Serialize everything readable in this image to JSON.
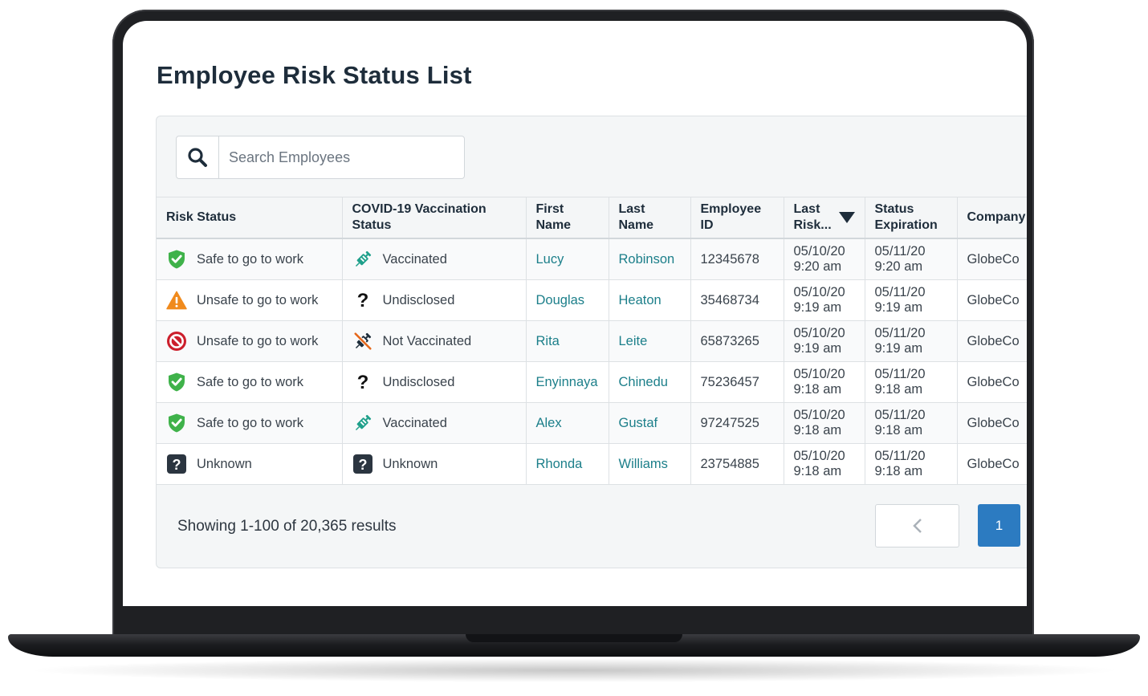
{
  "page": {
    "title": "Employee Risk Status List"
  },
  "search": {
    "placeholder": "Search Employees"
  },
  "table": {
    "headers": {
      "risk_status": "Risk Status",
      "vaccination": "COVID-19 Vaccination Status",
      "first_name": "First Name",
      "last_name": "Last Name",
      "employee_id": "Employee ID",
      "last_risk": "Last Risk...",
      "status_expiration": "Status Expiration",
      "company": "Company"
    },
    "rows": [
      {
        "risk_icon": "shield-check-icon",
        "risk": "Safe to go to work",
        "vacc_icon": "syringe-icon",
        "vacc": "Vaccinated",
        "first": "Lucy",
        "last": "Robinson",
        "id": "12345678",
        "last_risk_date": "05/10/20",
        "last_risk_time": "9:20 am",
        "exp_date": "05/11/20",
        "exp_time": "9:20 am",
        "company": "GlobeCo"
      },
      {
        "risk_icon": "warning-icon",
        "risk": "Unsafe to go to work",
        "vacc_icon": "question-icon",
        "vacc": "Undisclosed",
        "first": "Douglas",
        "last": "Heaton",
        "id": "35468734",
        "last_risk_date": "05/10/20",
        "last_risk_time": "9:19 am",
        "exp_date": "05/11/20",
        "exp_time": "9:19 am",
        "company": "GlobeCo"
      },
      {
        "risk_icon": "prohibited-icon",
        "risk": "Unsafe to go to work",
        "vacc_icon": "syringe-crossed-icon",
        "vacc": "Not Vaccinated",
        "first": "Rita",
        "last": "Leite",
        "id": "65873265",
        "last_risk_date": "05/10/20",
        "last_risk_time": "9:19 am",
        "exp_date": "05/11/20",
        "exp_time": "9:19 am",
        "company": "GlobeCo"
      },
      {
        "risk_icon": "shield-check-icon",
        "risk": "Safe to go to work",
        "vacc_icon": "question-icon",
        "vacc": "Undisclosed",
        "first": "Enyinnaya",
        "last": "Chinedu",
        "id": "75236457",
        "last_risk_date": "05/10/20",
        "last_risk_time": "9:18 am",
        "exp_date": "05/11/20",
        "exp_time": "9:18 am",
        "company": "GlobeCo"
      },
      {
        "risk_icon": "shield-check-icon",
        "risk": "Safe to go to work",
        "vacc_icon": "syringe-icon",
        "vacc": "Vaccinated",
        "first": "Alex",
        "last": "Gustaf",
        "id": "97247525",
        "last_risk_date": "05/10/20",
        "last_risk_time": "9:18 am",
        "exp_date": "05/11/20",
        "exp_time": "9:18 am",
        "company": "GlobeCo"
      },
      {
        "risk_icon": "unknown-box-icon",
        "risk": "Unknown",
        "vacc_icon": "unknown-box-icon",
        "vacc": "Unknown",
        "first": "Rhonda",
        "last": "Williams",
        "id": "23754885",
        "last_risk_date": "05/10/20",
        "last_risk_time": "9:18 am",
        "exp_date": "05/11/20",
        "exp_time": "9:18 am",
        "company": "GlobeCo"
      }
    ]
  },
  "footer": {
    "results": "Showing 1-100 of 20,365 results"
  },
  "pagination": {
    "prev_icon": "chevron-left-icon",
    "current_page": "1"
  },
  "colors": {
    "accent": "#2c7bc1",
    "link": "#1c7f8a",
    "safe": "#3fb24a",
    "warning": "#f08a1c",
    "danger": "#cc1f2c",
    "title": "#1e2d3b"
  }
}
